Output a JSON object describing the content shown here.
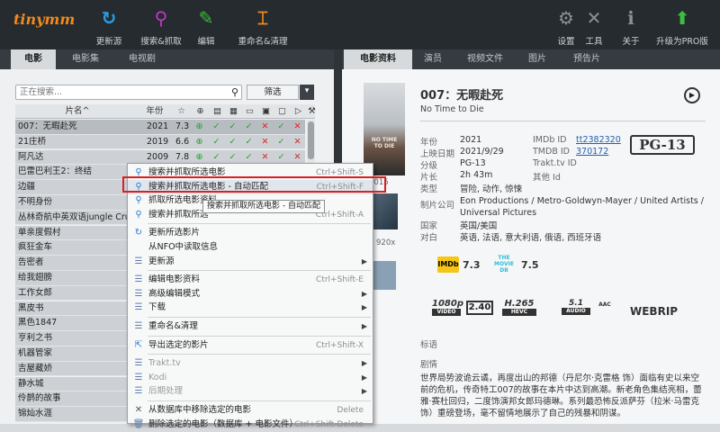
{
  "app": {
    "logo": "tinymm"
  },
  "toolbar": {
    "left": [
      {
        "label": "更新源",
        "icon": "refresh-icon",
        "glyph": "↻",
        "color": "#2a9de6"
      },
      {
        "label": "搜索&抓取",
        "icon": "search-icon",
        "glyph": "⚲",
        "color": "#c437c6"
      },
      {
        "label": "编辑",
        "icon": "pencil-icon",
        "glyph": "✎",
        "color": "#3cbf3c"
      },
      {
        "label": "重命名&清理",
        "icon": "rename-icon",
        "glyph": "⌶",
        "color": "#f28a1d"
      }
    ],
    "right": [
      {
        "label": "设置",
        "icon": "gear-icon",
        "glyph": "⚙",
        "color": "#8a9096"
      },
      {
        "label": "工具",
        "icon": "tools-icon",
        "glyph": "✕",
        "color": "#8a9096"
      },
      {
        "label": "关于",
        "icon": "info-icon",
        "glyph": "ℹ",
        "color": "#8a9096"
      },
      {
        "label": "升级为PRO版",
        "icon": "upgrade-arrow-icon",
        "glyph": "⬆",
        "color": "#3cbf3c"
      }
    ]
  },
  "left_tabs": [
    "电影",
    "电影集",
    "电视剧"
  ],
  "right_tabs": [
    "电影资料",
    "演员",
    "视频文件",
    "图片",
    "预告片"
  ],
  "search": {
    "placeholder": "正在搜索...",
    "filter_label": "筛选"
  },
  "table": {
    "col_title": "片名^",
    "col_year": "年份",
    "col_icons": [
      "star-icon",
      "plus-circle-icon",
      "image-icon",
      "picture-icon",
      "document-icon",
      "subtitle-icon",
      "chat-icon",
      "play-icon",
      "wrench-icon"
    ],
    "col_glyphs": [
      "☆",
      "⊕",
      "▤",
      "▦",
      "▭",
      "▣",
      "▢",
      "▷",
      "⚒"
    ],
    "rows": [
      {
        "title": "007：无暇赴死",
        "year": "2021",
        "rating": "7.3",
        "flags": [
          "+",
          "ok",
          "ok",
          "ok",
          "no",
          "ok",
          "no"
        ]
      },
      {
        "title": "21庄桥",
        "year": "2019",
        "rating": "6.6",
        "flags": [
          "+",
          "ok",
          "ok",
          "ok",
          "no",
          "ok",
          "no"
        ]
      },
      {
        "title": "阿凡达",
        "year": "2009",
        "rating": "7.8",
        "flags": [
          "+",
          "ok",
          "ok",
          "ok",
          "no",
          "ok",
          "no"
        ]
      },
      {
        "title": "巴雷巴利王2：终结",
        "year": "",
        "rating": "",
        "flags": []
      },
      {
        "title": "边疆",
        "year": "",
        "rating": "",
        "flags": []
      },
      {
        "title": "不明身份",
        "year": "",
        "rating": "",
        "flags": []
      },
      {
        "title": "丛林奇航中英双语jungle Cruise",
        "year": "",
        "rating": "",
        "flags": []
      },
      {
        "title": "单亲度假村",
        "year": "",
        "rating": "",
        "flags": []
      },
      {
        "title": "疯狂金车",
        "year": "",
        "rating": "",
        "flags": []
      },
      {
        "title": "告密者",
        "year": "",
        "rating": "",
        "flags": []
      },
      {
        "title": "给我翅膀",
        "year": "",
        "rating": "",
        "flags": []
      },
      {
        "title": "工作女郎",
        "year": "",
        "rating": "",
        "flags": []
      },
      {
        "title": "黑皮书",
        "year": "",
        "rating": "",
        "flags": []
      },
      {
        "title": "黑色1847",
        "year": "",
        "rating": "",
        "flags": []
      },
      {
        "title": "亨利之书",
        "year": "",
        "rating": "",
        "flags": []
      },
      {
        "title": "机器管家",
        "year": "",
        "rating": "",
        "flags": []
      },
      {
        "title": "吉屋藏娇",
        "year": "",
        "rating": "",
        "flags": []
      },
      {
        "title": "静水城",
        "year": "",
        "rating": "",
        "flags": []
      },
      {
        "title": "伶鹊的故事",
        "year": "",
        "rating": "",
        "flags": []
      },
      {
        "title": "锦灿水涯",
        "year": "",
        "rating": "",
        "flags": []
      }
    ]
  },
  "context_menu": {
    "items": [
      {
        "label": "搜索并抓取所选电影",
        "shortcut": "Ctrl+Shift-S",
        "icon": "search-icon",
        "arrow": false,
        "disabled": false
      },
      {
        "label": "搜索并抓取所选电影 - 自动匹配",
        "shortcut": "Ctrl+Shift-F",
        "icon": "search-icon",
        "arrow": false,
        "disabled": false,
        "highlight": true
      },
      {
        "label": "抓取所选电影资料",
        "shortcut": "",
        "icon": "search-icon",
        "arrow": false,
        "disabled": false
      },
      {
        "label": "搜索并抓取所选",
        "shortcut": "Ctrl+Shift-A",
        "icon": "search-icon",
        "arrow": false,
        "disabled": false
      },
      {
        "sep": true
      },
      {
        "label": "更新所选影片",
        "shortcut": "",
        "icon": "refresh-icon",
        "arrow": false,
        "disabled": false
      },
      {
        "label": "从NFO中读取信息",
        "shortcut": "",
        "icon": "",
        "arrow": false,
        "disabled": false
      },
      {
        "label": "更新源",
        "shortcut": "",
        "icon": "list-icon",
        "arrow": true,
        "disabled": false
      },
      {
        "sep": true
      },
      {
        "label": "编辑电影资料",
        "shortcut": "Ctrl+Shift-E",
        "icon": "list-icon",
        "arrow": false,
        "disabled": false
      },
      {
        "label": "高级编辑模式",
        "shortcut": "",
        "icon": "list-icon",
        "arrow": true,
        "disabled": false
      },
      {
        "label": "下载",
        "shortcut": "",
        "icon": "list-icon",
        "arrow": true,
        "disabled": false
      },
      {
        "sep": true
      },
      {
        "label": "重命名&清理",
        "shortcut": "",
        "icon": "list-icon",
        "arrow": true,
        "disabled": false
      },
      {
        "sep": true
      },
      {
        "label": "导出选定的影片",
        "shortcut": "Ctrl+Shift-X",
        "icon": "export-icon",
        "arrow": false,
        "disabled": false
      },
      {
        "sep": true
      },
      {
        "label": "Trakt.tv",
        "shortcut": "",
        "icon": "list-icon",
        "arrow": true,
        "disabled": true
      },
      {
        "label": "Kodi",
        "shortcut": "",
        "icon": "list-icon",
        "arrow": true,
        "disabled": true
      },
      {
        "label": "后期处理",
        "shortcut": "",
        "icon": "list-icon",
        "arrow": true,
        "disabled": true
      },
      {
        "sep": true
      },
      {
        "label": "从数据库中移除选定的电影",
        "shortcut": "Delete",
        "icon": "close-icon",
        "arrow": false,
        "disabled": false
      },
      {
        "label": "删除选定的电影（数据库 + 电影文件）",
        "shortcut": "Ctrl+Shift-Delete",
        "icon": "trash-icon",
        "arrow": false,
        "disabled": false
      }
    ]
  },
  "tooltip": "搜索并抓取所选电影 - 自动匹配",
  "detail": {
    "poster_text": "NO TIME TO DIE",
    "title": "007：无暇赴死",
    "original_title": "No Time to Die",
    "labels": {
      "year": "年份",
      "release": "上映日期",
      "cert": "分级",
      "runtime": "片长",
      "genre": "类型",
      "studio": "制片公司",
      "country": "国家",
      "language": "对白",
      "imdb": "IMDb ID",
      "tmdb": "TMDB ID",
      "trakt": "Trakt.tv ID",
      "id": "其他 Id",
      "tags": "标语",
      "plot": "剧情"
    },
    "year": "2021",
    "release": "2021/9/29",
    "cert": "PG-13",
    "runtime": "2h 43m",
    "genre": "冒险, 动作, 惊悚",
    "studio": "Eon Productions / Metro-Goldwyn-Mayer / United Artists / Universal Pictures",
    "country": "英国/美国",
    "language": "英语, 法语, 意大利语, 俄语, 西班牙语",
    "imdb_id": "tt2382320",
    "tmdb_id": "370172",
    "rating_badge": "PG-13",
    "side_text_1": "2015",
    "side_text_2": "920x",
    "imdb_logo": "IMDb",
    "imdb_score": "7.3",
    "tmdb_logo": "THE MOVIE DB",
    "tmdb_score": "7.5",
    "media": {
      "resolution": "1080p",
      "resolution_sub": "VIDEO",
      "channels_box": "2.40",
      "codec": "H.265",
      "codec_sub": "HEVC",
      "audio": "5.1",
      "audio_sub": "AUDIO",
      "aac": "AAC",
      "source": "WEBRIP"
    },
    "plot": "世界局势波诡云谲，再度出山的邦德（丹尼尔·克雷格 饰）面临有史以来空前的危机，传奇特工007的故事在本片中达到高潮。新老角色集结亮相，蕾雅·赛杜回归，二度饰演邦女郎玛德琳。系列最恐怖反派萨芬（拉米·马雷克 饰）重磅登场，毫不留情地展示了自己的残暴和阴谋。"
  },
  "colors": {
    "accent": "#f28a1d",
    "ok": "#1fa22f",
    "no": "#d82929",
    "link": "#1f5fb0",
    "redbox": "#d92020"
  }
}
